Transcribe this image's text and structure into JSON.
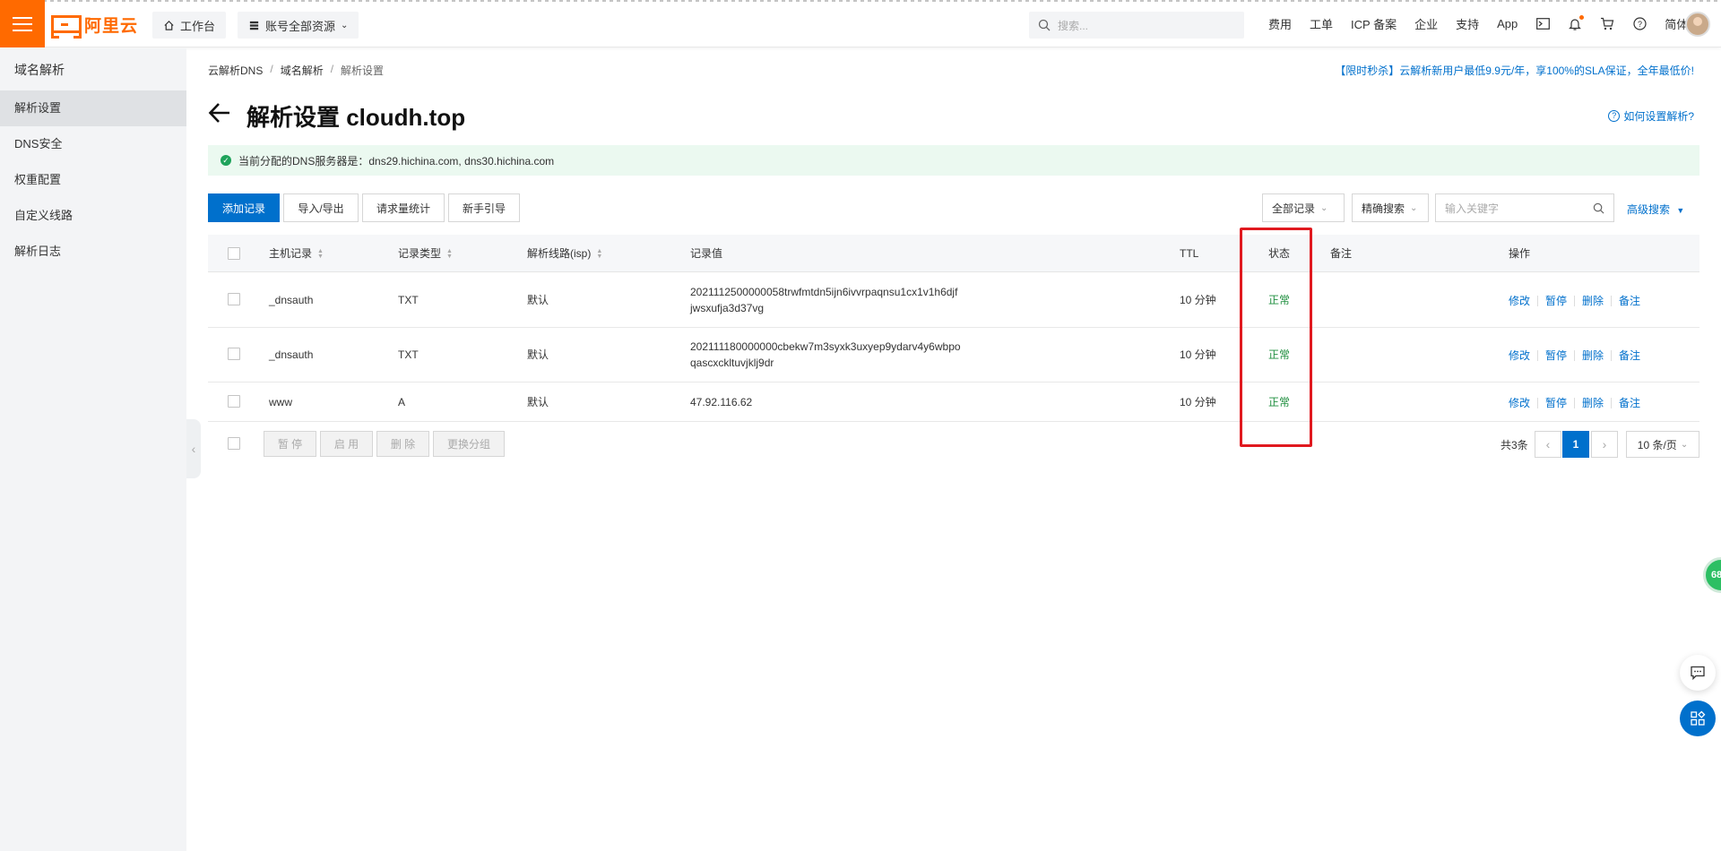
{
  "header": {
    "logo_text": "阿里云",
    "workbench": "工作台",
    "resources": "账号全部资源",
    "search_placeholder": "搜索...",
    "nav": [
      "费用",
      "工单",
      "ICP 备案",
      "企业",
      "支持",
      "App"
    ],
    "lang": "简体",
    "brand_color": "#ff6a00"
  },
  "sidebar": {
    "title": "域名解析",
    "items": [
      {
        "label": "解析设置",
        "active": true
      },
      {
        "label": "DNS安全"
      },
      {
        "label": "权重配置"
      },
      {
        "label": "自定义线路"
      },
      {
        "label": "解析日志"
      }
    ]
  },
  "breadcrumb": [
    "云解析DNS",
    "域名解析",
    "解析设置"
  ],
  "promo": "【限时秒杀】云解析新用户最低9.9元/年，享100%的SLA保证，全年最低价!",
  "page": {
    "title": "解析设置 cloudh.top",
    "howto": "如何设置解析?"
  },
  "notice": {
    "label": "当前分配的DNS服务器是：",
    "servers": "dns29.hichina.com, dns30.hichina.com"
  },
  "toolbar": {
    "add": "添加记录",
    "import_export": "导入/导出",
    "stats": "请求量统计",
    "guide": "新手引导",
    "filter": "全部记录",
    "search_mode": "精确搜索",
    "keyword_placeholder": "输入关键字",
    "advanced": "高级搜索"
  },
  "table": {
    "columns": [
      "主机记录",
      "记录类型",
      "解析线路(isp)",
      "记录值",
      "TTL",
      "状态",
      "备注",
      "操作"
    ],
    "rows": [
      {
        "host": "_dnsauth",
        "type": "TXT",
        "line": "默认",
        "value1": "2021112500000058trwfmtdn5ijn6ivvrpaqnsu1cx1v1h6djf",
        "value2": "jwsxufja3d37vg",
        "ttl": "10 分钟",
        "status": "正常",
        "remark": ""
      },
      {
        "host": "_dnsauth",
        "type": "TXT",
        "line": "默认",
        "value1": "202111180000000cbekw7m3syxk3uxyep9ydarv4y6wbpo",
        "value2": "qascxckltuvjklj9dr",
        "ttl": "10 分钟",
        "status": "正常",
        "remark": ""
      },
      {
        "host": "www",
        "type": "A",
        "line": "默认",
        "value1": "47.92.116.62",
        "value2": "",
        "ttl": "10 分钟",
        "status": "正常",
        "remark": ""
      }
    ],
    "ops": [
      "修改",
      "暂停",
      "删除",
      "备注"
    ]
  },
  "batch": {
    "pause": "暂 停",
    "enable": "启 用",
    "delete": "删 除",
    "group": "更换分组"
  },
  "pagination": {
    "total": "共3条",
    "current": "1",
    "page_size": "10 条/页"
  },
  "floating": {
    "badge": "68"
  }
}
